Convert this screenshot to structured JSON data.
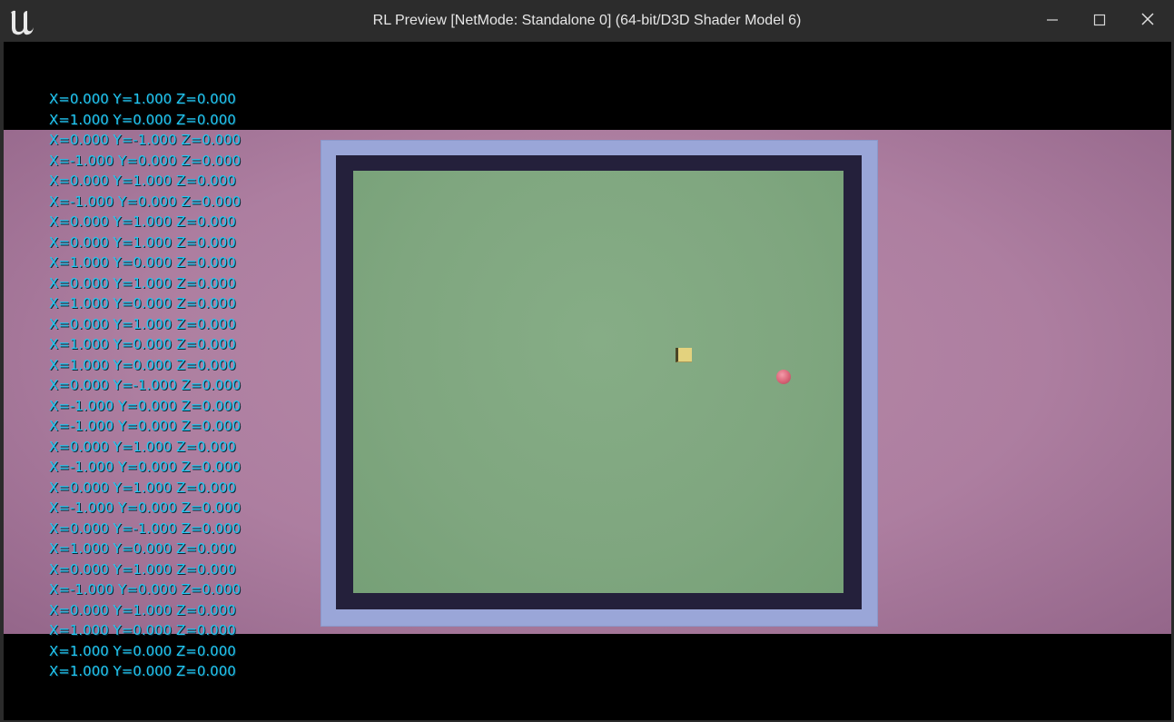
{
  "window": {
    "title": "RL Preview [NetMode: Standalone 0]  (64-bit/D3D Shader Model 6)",
    "logo_icon": "unreal-engine-logo-icon",
    "controls": {
      "minimize_icon": "minimize-icon",
      "maximize_icon": "maximize-icon",
      "close_icon": "close-icon"
    }
  },
  "viewport": {
    "colors": {
      "background": "#000000",
      "floor": "#b184a4",
      "wall": "#9aa6d8",
      "wall_inner": "#24203b",
      "arena": "#80a780",
      "agent_cube": "#e3d27e",
      "target_ball": "#e07084",
      "log_text": "#21c7f2"
    },
    "objects": {
      "agent_cube": "agent-cube",
      "target_ball": "target-ball"
    },
    "debug_log": [
      "X=0.000 Y=1.000 Z=0.000",
      "X=1.000 Y=0.000 Z=0.000",
      "X=0.000 Y=-1.000 Z=0.000",
      "X=-1.000 Y=0.000 Z=0.000",
      "X=0.000 Y=1.000 Z=0.000",
      "X=-1.000 Y=0.000 Z=0.000",
      "X=0.000 Y=1.000 Z=0.000",
      "X=0.000 Y=1.000 Z=0.000",
      "X=1.000 Y=0.000 Z=0.000",
      "X=0.000 Y=1.000 Z=0.000",
      "X=1.000 Y=0.000 Z=0.000",
      "X=0.000 Y=1.000 Z=0.000",
      "X=1.000 Y=0.000 Z=0.000",
      "X=1.000 Y=0.000 Z=0.000",
      "X=0.000 Y=-1.000 Z=0.000",
      "X=-1.000 Y=0.000 Z=0.000",
      "X=-1.000 Y=0.000 Z=0.000",
      "X=0.000 Y=1.000 Z=0.000",
      "X=-1.000 Y=0.000 Z=0.000",
      "X=0.000 Y=1.000 Z=0.000",
      "X=-1.000 Y=0.000 Z=0.000",
      "X=0.000 Y=-1.000 Z=0.000",
      "X=1.000 Y=0.000 Z=0.000",
      "X=0.000 Y=1.000 Z=0.000",
      "X=-1.000 Y=0.000 Z=0.000",
      "X=0.000 Y=1.000 Z=0.000",
      "X=1.000 Y=0.000 Z=0.000",
      "X=1.000 Y=0.000 Z=0.000",
      "X=1.000 Y=0.000 Z=0.000"
    ]
  }
}
